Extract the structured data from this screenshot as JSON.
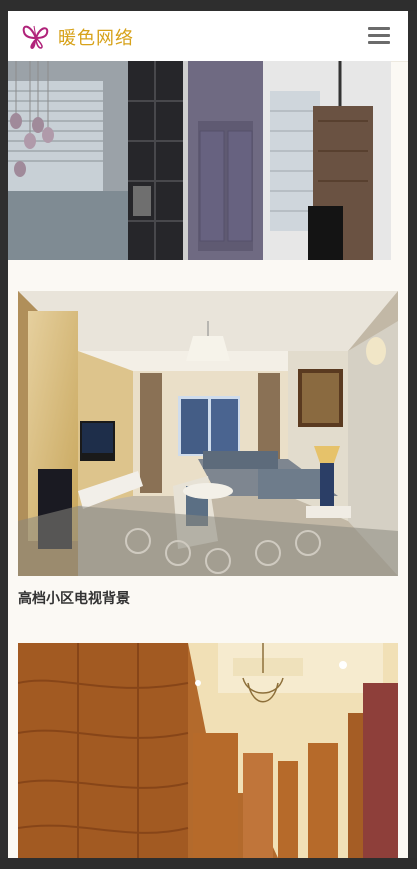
{
  "header": {
    "brand": "暖色网络",
    "logo_icon": "butterfly-icon",
    "menu_icon": "hamburger-menu-icon"
  },
  "gallery": {
    "items": [
      {
        "title": ""
      },
      {
        "title": "高档小区电视背景"
      },
      {
        "title": ""
      }
    ]
  },
  "colors": {
    "brand": "#d7a21a",
    "logo": "#b0237a",
    "page_background": "#fbf9f4"
  }
}
